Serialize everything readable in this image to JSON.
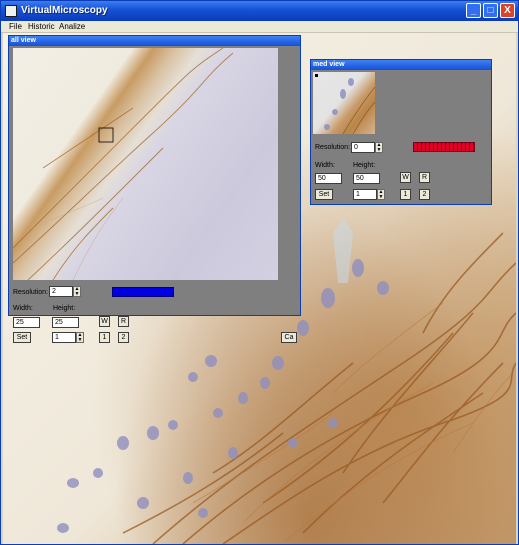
{
  "window": {
    "title": "VirtualMicroscopy",
    "minimize_symbol": "_",
    "maximize_symbol": "□",
    "close_symbol": "X"
  },
  "menu": [
    "File",
    "Historic",
    "Analize"
  ],
  "all_view": {
    "title": "all view",
    "resolution_label": "Resolution:",
    "resolution_value": "2",
    "bar_color": "#0000e0",
    "width_label": "Width:",
    "height_label": "Height:",
    "width_value": "25",
    "height_value": "25",
    "set_label": "Set",
    "spin_value": "1",
    "w_label": "W",
    "r_label": "R",
    "one_label": "1",
    "two_label": "2",
    "ca_label": "Ca"
  },
  "med_view": {
    "title": "med view",
    "resolution_label": "Resolution:",
    "resolution_value": "0",
    "bar_color": "#e0002a",
    "width_label": "Width:",
    "height_label": "Height:",
    "width_value": "50",
    "height_value": "50",
    "set_label": "Set",
    "spin_value": "1",
    "w_label": "W",
    "r_label": "R",
    "one_label": "1",
    "two_label": "2"
  }
}
